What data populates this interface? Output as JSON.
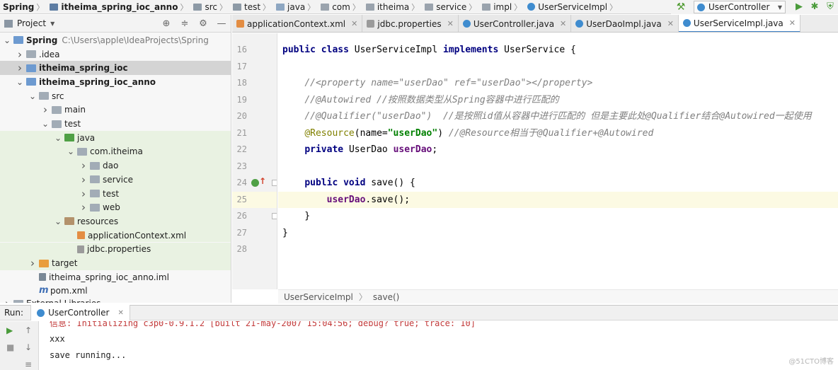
{
  "breadcrumb": [
    {
      "label": "Spring",
      "bold": true,
      "icon": "module"
    },
    {
      "label": "itheima_spring_ioc_anno",
      "bold": true,
      "icon": "module"
    },
    {
      "label": "src",
      "icon": "folder"
    },
    {
      "label": "test",
      "icon": "folder"
    },
    {
      "label": "java",
      "icon": "source-folder"
    },
    {
      "label": "com",
      "icon": "package"
    },
    {
      "label": "itheima",
      "icon": "package"
    },
    {
      "label": "service",
      "icon": "package"
    },
    {
      "label": "impl",
      "icon": "package"
    },
    {
      "label": "UserServiceImpl",
      "icon": "class"
    }
  ],
  "toolbar": {
    "run_config": "UserController"
  },
  "project": {
    "title": "Project",
    "tree": [
      {
        "label": "Spring",
        "path": "C:\\Users\\apple\\IdeaProjects\\Spring",
        "indent": 0,
        "arrow": "down",
        "icon": "module",
        "bold": true
      },
      {
        "label": ".idea",
        "indent": 1,
        "arrow": "right",
        "icon": "folder"
      },
      {
        "label": "itheima_spring_ioc",
        "indent": 1,
        "arrow": "right",
        "icon": "module",
        "bold": true,
        "selected": true
      },
      {
        "label": "itheima_spring_ioc_anno",
        "indent": 1,
        "arrow": "down",
        "icon": "module",
        "bold": true
      },
      {
        "label": "src",
        "indent": 2,
        "arrow": "down",
        "icon": "folder"
      },
      {
        "label": "main",
        "indent": 3,
        "arrow": "right",
        "icon": "folder"
      },
      {
        "label": "test",
        "indent": 3,
        "arrow": "down",
        "icon": "folder"
      },
      {
        "label": "java",
        "indent": 4,
        "arrow": "down",
        "icon": "test-source",
        "green": true
      },
      {
        "label": "com.itheima",
        "indent": 5,
        "arrow": "down",
        "icon": "package",
        "green": true
      },
      {
        "label": "dao",
        "indent": 6,
        "arrow": "right",
        "icon": "package",
        "green": true
      },
      {
        "label": "service",
        "indent": 6,
        "arrow": "right",
        "icon": "package",
        "green": true
      },
      {
        "label": "test",
        "indent": 6,
        "arrow": "right",
        "icon": "package",
        "green": true
      },
      {
        "label": "web",
        "indent": 6,
        "arrow": "right",
        "icon": "package",
        "green": true
      },
      {
        "label": "resources",
        "indent": 4,
        "arrow": "down",
        "icon": "resources",
        "green": true
      },
      {
        "label": "applicationContext.xml",
        "indent": 5,
        "arrow": "",
        "icon": "xml",
        "green": true
      },
      {
        "label": "jdbc.properties",
        "indent": 5,
        "arrow": "",
        "icon": "properties",
        "green": true
      },
      {
        "label": "target",
        "indent": 2,
        "arrow": "right",
        "icon": "excluded-folder",
        "orange": true
      },
      {
        "label": "itheima_spring_ioc_anno.iml",
        "indent": 2,
        "arrow": "",
        "icon": "iml"
      },
      {
        "label": "pom.xml",
        "indent": 2,
        "arrow": "",
        "icon": "maven"
      },
      {
        "label": "External Libraries",
        "indent": 0,
        "arrow": "right",
        "icon": "library",
        "partial": true
      }
    ]
  },
  "tabs": [
    {
      "label": "applicationContext.xml",
      "icon": "xml"
    },
    {
      "label": "jdbc.properties",
      "icon": "properties"
    },
    {
      "label": "UserController.java",
      "icon": "class"
    },
    {
      "label": "UserDaoImpl.java",
      "icon": "class"
    },
    {
      "label": "UserServiceImpl.java",
      "icon": "class",
      "active": true
    }
  ],
  "editor": {
    "lines": [
      {
        "n": "16",
        "tokens": [
          [
            "kw",
            "public "
          ],
          [
            "kw",
            "class "
          ],
          [
            "",
            "UserServiceImpl "
          ],
          [
            "kw",
            "implements "
          ],
          [
            "",
            "UserService {"
          ]
        ]
      },
      {
        "n": "17",
        "tokens": []
      },
      {
        "n": "18",
        "tokens": [
          [
            "",
            "    "
          ],
          [
            "cm",
            "//<property name=\"userDao\" ref=\"userDao\"></property>"
          ]
        ]
      },
      {
        "n": "19",
        "tokens": [
          [
            "",
            "    "
          ],
          [
            "cm",
            "//@Autowired //按照数据类型从Spring容器中进行匹配的"
          ]
        ]
      },
      {
        "n": "20",
        "tokens": [
          [
            "",
            "    "
          ],
          [
            "cm",
            "//@Qualifier(\"userDao\")  //是按照id值从容器中进行匹配的 但是主要此处@Qualifier结合@Autowired一起使用"
          ]
        ]
      },
      {
        "n": "21",
        "tokens": [
          [
            "",
            "    "
          ],
          [
            "ann",
            "@Resource"
          ],
          [
            "",
            "(name="
          ],
          [
            "str",
            "\"userDao\""
          ],
          [
            "",
            ") "
          ],
          [
            "cm",
            "//@Resource相当于@Qualifier+@Autowired"
          ]
        ]
      },
      {
        "n": "22",
        "tokens": [
          [
            "",
            "    "
          ],
          [
            "kw",
            "private "
          ],
          [
            "",
            "UserDao "
          ],
          [
            "fld",
            "userDao"
          ],
          [
            "",
            ";"
          ]
        ]
      },
      {
        "n": "23",
        "tokens": []
      },
      {
        "n": "24",
        "tokens": [
          [
            "",
            "    "
          ],
          [
            "kw",
            "public "
          ],
          [
            "kw",
            "void "
          ],
          [
            "",
            "save() {"
          ]
        ]
      },
      {
        "n": "25",
        "tokens": [
          [
            "",
            "        "
          ],
          [
            "fld",
            "userDao"
          ],
          [
            "",
            ".save();"
          ]
        ],
        "highlight": true
      },
      {
        "n": "26",
        "tokens": [
          [
            "",
            "    }"
          ]
        ]
      },
      {
        "n": "27",
        "tokens": [
          [
            "",
            "}"
          ]
        ]
      },
      {
        "n": "28",
        "tokens": []
      }
    ],
    "footer": {
      "cls": "UserServiceImpl",
      "sep": "〉",
      "method": "save()"
    }
  },
  "run": {
    "label": "Run:",
    "tab": "UserController",
    "console": [
      {
        "text": "信息: Initializing c3p0-0.9.1.2 [built 21-may-2007 15:04:56; debug? true; trace: 10]",
        "err": true
      },
      {
        "text": "xxx"
      },
      {
        "text": "save running..."
      }
    ]
  },
  "watermark": "@51CTO博客",
  "colors": {
    "accent": "#4083c9",
    "keyword": "#000080",
    "comment": "#808080",
    "annotation": "#808000",
    "string": "#008000",
    "field": "#660e7a"
  }
}
